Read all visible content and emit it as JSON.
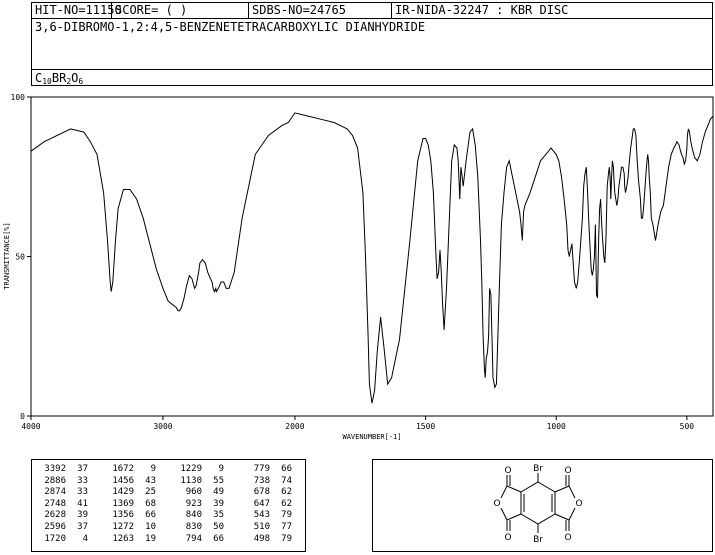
{
  "header": {
    "hit_no": "HIT-NO=11150",
    "score": "SCORE=  (   )",
    "sdbs_no": "SDBS-NO=24765",
    "ir_code": "IR-NIDA-32247 : KBR DISC",
    "compound_name": "3,6-DIBROMO-1,2:4,5-BENZENETETRACARBOXYLIC DIANHYDRIDE",
    "formula_parts": [
      "C",
      "10",
      "BR",
      "2",
      "O",
      "6"
    ]
  },
  "chart_data": {
    "type": "line",
    "xlabel": "WAVENUMBER[-1]",
    "ylabel": "TRANSMITTANCE[%]",
    "xlim": [
      4000,
      400
    ],
    "ylim": [
      0,
      100
    ],
    "xticks": [
      "4000",
      "3000",
      "2000",
      "1500",
      "1000",
      "500"
    ],
    "xtick_values": [
      4000,
      3000,
      2000,
      1500,
      1000,
      500
    ],
    "yticks": [
      "100",
      "50",
      "0"
    ],
    "ytick_values": [
      100,
      50,
      0
    ],
    "grid": false,
    "line_color": "#000000",
    "x": [
      4000,
      3900,
      3800,
      3700,
      3600,
      3550,
      3500,
      3450,
      3420,
      3400,
      3392,
      3380,
      3360,
      3340,
      3300,
      3250,
      3200,
      3150,
      3100,
      3050,
      3000,
      2960,
      2930,
      2900,
      2886,
      2874,
      2860,
      2840,
      2820,
      2800,
      2780,
      2760,
      2748,
      2730,
      2720,
      2700,
      2680,
      2660,
      2640,
      2628,
      2620,
      2610,
      2600,
      2596,
      2580,
      2560,
      2540,
      2520,
      2500,
      2460,
      2400,
      2300,
      2200,
      2100,
      2050,
      2000,
      1950,
      1900,
      1850,
      1800,
      1780,
      1760,
      1740,
      1730,
      1720,
      1715,
      1705,
      1695,
      1685,
      1672,
      1660,
      1645,
      1630,
      1600,
      1560,
      1530,
      1510,
      1500,
      1490,
      1480,
      1470,
      1465,
      1460,
      1456,
      1450,
      1445,
      1440,
      1435,
      1429,
      1420,
      1410,
      1400,
      1390,
      1380,
      1375,
      1369,
      1365,
      1360,
      1356,
      1345,
      1330,
      1320,
      1310,
      1300,
      1290,
      1285,
      1280,
      1275,
      1272,
      1268,
      1263,
      1259,
      1255,
      1250,
      1242,
      1235,
      1229,
      1225,
      1218,
      1210,
      1200,
      1190,
      1180,
      1170,
      1160,
      1150,
      1140,
      1135,
      1130,
      1125,
      1120,
      1100,
      1080,
      1060,
      1040,
      1020,
      1000,
      990,
      980,
      970,
      960,
      955,
      950,
      945,
      940,
      935,
      930,
      923,
      918,
      910,
      900,
      895,
      890,
      885,
      880,
      875,
      870,
      866,
      862,
      858,
      854,
      850,
      846,
      842,
      840,
      838,
      834,
      830,
      826,
      822,
      818,
      814,
      810,
      805,
      800,
      797,
      794,
      791,
      788,
      785,
      781,
      779,
      776,
      772,
      768,
      764,
      760,
      755,
      750,
      745,
      740,
      738,
      735,
      730,
      725,
      720,
      715,
      710,
      705,
      700,
      695,
      690,
      685,
      680,
      678,
      674,
      670,
      666,
      660,
      655,
      650,
      647,
      644,
      640,
      636,
      630,
      620,
      610,
      600,
      590,
      580,
      570,
      560,
      550,
      543,
      538,
      530,
      524,
      520,
      515,
      510,
      505,
      500,
      498,
      494,
      490,
      485,
      480,
      470,
      460,
      450,
      440,
      430,
      420,
      410,
      400
    ],
    "y": [
      83,
      86,
      88,
      90,
      89,
      86,
      82,
      70,
      55,
      42,
      39,
      42,
      55,
      65,
      71,
      71,
      68,
      62,
      54,
      46,
      40,
      36,
      35,
      34,
      33,
      33,
      34,
      37,
      41,
      44,
      43,
      40,
      41,
      45,
      48,
      49,
      48,
      45,
      43,
      42,
      40,
      39,
      40,
      39,
      40,
      42,
      42,
      40,
      40,
      45,
      62,
      82,
      88,
      91,
      92,
      95,
      94,
      93,
      92,
      90,
      88,
      84,
      70,
      50,
      25,
      10,
      4,
      8,
      20,
      31,
      22,
      10,
      12,
      24,
      55,
      80,
      87,
      87,
      85,
      80,
      70,
      60,
      50,
      43,
      45,
      52,
      45,
      35,
      27,
      40,
      60,
      80,
      85,
      84,
      80,
      68,
      78,
      75,
      72,
      80,
      89,
      90,
      85,
      75,
      55,
      42,
      25,
      15,
      12,
      18,
      20,
      25,
      40,
      38,
      12,
      9,
      10,
      20,
      40,
      60,
      70,
      78,
      80,
      76,
      72,
      68,
      64,
      60,
      55,
      64,
      66,
      70,
      75,
      80,
      82,
      84,
      82,
      80,
      75,
      68,
      60,
      52,
      50,
      52,
      54,
      48,
      42,
      40,
      42,
      50,
      62,
      72,
      76,
      78,
      70,
      60,
      52,
      46,
      44,
      46,
      50,
      60,
      38,
      37,
      45,
      55,
      65,
      68,
      60,
      55,
      50,
      48,
      55,
      72,
      76,
      78,
      75,
      68,
      75,
      80,
      78,
      74,
      70,
      68,
      66,
      68,
      72,
      75,
      78,
      78,
      76,
      72,
      70,
      72,
      75,
      80,
      84,
      87,
      90,
      90,
      88,
      80,
      74,
      70,
      68,
      62,
      62,
      65,
      72,
      78,
      82,
      80,
      75,
      70,
      62,
      60,
      55,
      60,
      64,
      66,
      72,
      78,
      82,
      84,
      85,
      86,
      85,
      83,
      82,
      81,
      79,
      80,
      84,
      88,
      90,
      89,
      86,
      84,
      81,
      80,
      82,
      86,
      89,
      91,
      93,
      94,
      93,
      90,
      87,
      85,
      86
    ]
  },
  "peak_table": {
    "columns": [
      [
        [
          "3392",
          "37"
        ],
        [
          "2886",
          "33"
        ],
        [
          "2874",
          "33"
        ],
        [
          "2748",
          "41"
        ],
        [
          "2628",
          "39"
        ],
        [
          "2596",
          "37"
        ],
        [
          "1720",
          "4"
        ]
      ],
      [
        [
          "1672",
          "9"
        ],
        [
          "1456",
          "43"
        ],
        [
          "1429",
          "25"
        ],
        [
          "1369",
          "68"
        ],
        [
          "1356",
          "66"
        ],
        [
          "1272",
          "10"
        ],
        [
          "1263",
          "19"
        ]
      ],
      [
        [
          "1229",
          "9"
        ],
        [
          "1130",
          "55"
        ],
        [
          "960",
          "49"
        ],
        [
          "923",
          "39"
        ],
        [
          "840",
          "35"
        ],
        [
          "830",
          "50"
        ],
        [
          "794",
          "66"
        ]
      ],
      [
        [
          "779",
          "66"
        ],
        [
          "738",
          "74"
        ],
        [
          "678",
          "62"
        ],
        [
          "647",
          "62"
        ],
        [
          "543",
          "79"
        ],
        [
          "510",
          "77"
        ],
        [
          "498",
          "79"
        ]
      ]
    ]
  },
  "structure": {
    "top_substituent": "Br",
    "bottom_substituent": "Br",
    "carbonyl_label": "O",
    "ring_oxygen_label": "O"
  }
}
